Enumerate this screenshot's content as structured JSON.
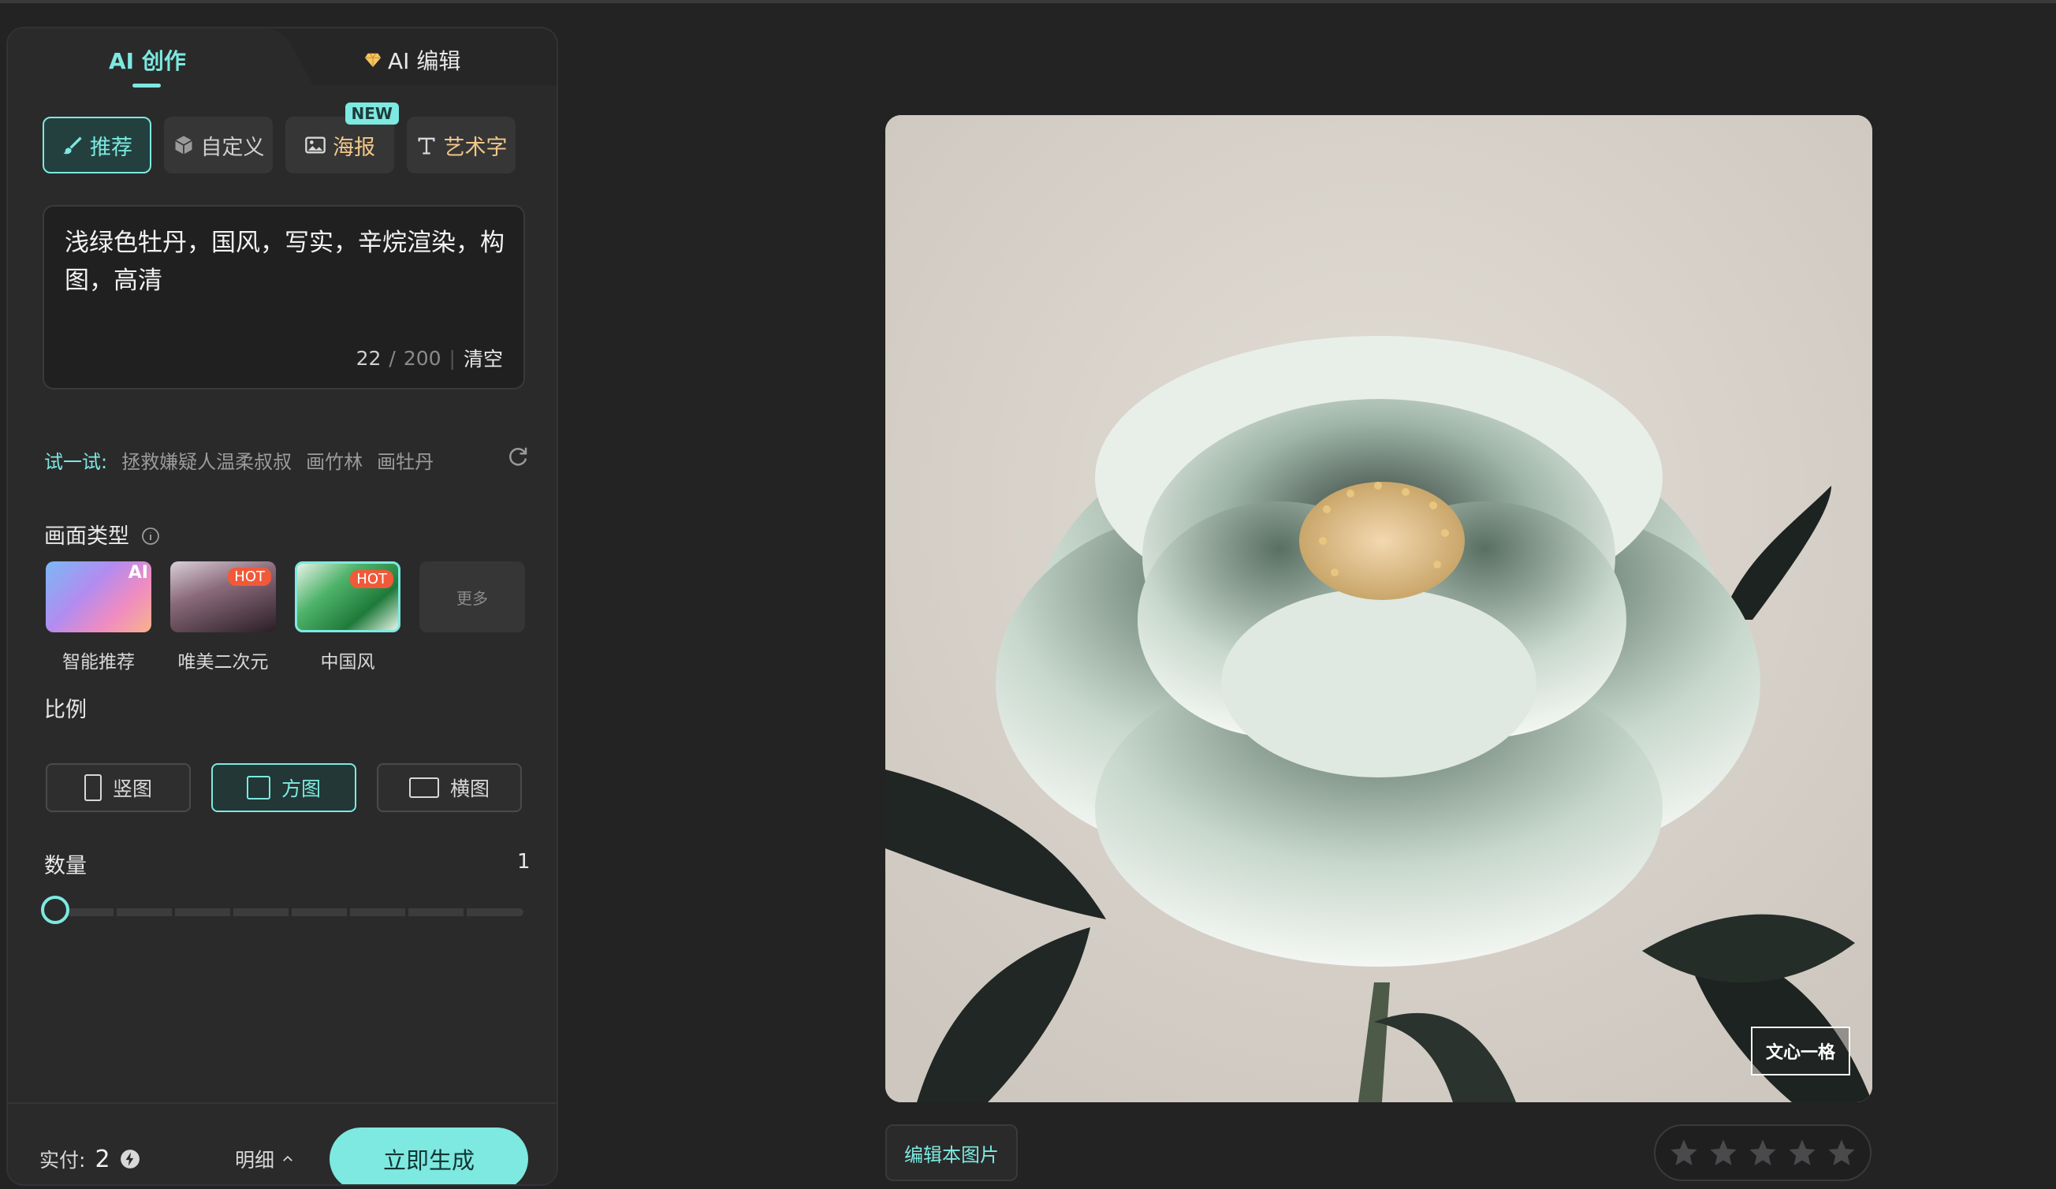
{
  "tabs": {
    "create": "AI 创作",
    "edit": "AI 编辑"
  },
  "modes": [
    {
      "label": "推荐",
      "icon": "brush-icon",
      "active": true
    },
    {
      "label": "自定义",
      "icon": "cube-icon",
      "active": false
    },
    {
      "label": "海报",
      "icon": "image-icon",
      "active": false,
      "badge": "NEW"
    },
    {
      "label": "艺术字",
      "icon": "art-text-icon",
      "active": false
    }
  ],
  "prompt": {
    "text": "浅绿色牡丹，国风，写实，辛烷渲染，构图，高清",
    "count": "22",
    "sep": "/",
    "max": "200",
    "clear": "清空"
  },
  "try": {
    "label": "试一试:",
    "items": [
      "拯救嫌疑人温柔叔叔",
      "画竹林",
      "画牡丹"
    ]
  },
  "style": {
    "title": "画面类型",
    "items": [
      {
        "label": "智能推荐",
        "badge": "AI"
      },
      {
        "label": "唯美二次元",
        "badge": "HOT"
      },
      {
        "label": "中国风",
        "badge": "HOT",
        "selected": true
      }
    ],
    "more": "更多"
  },
  "ratio": {
    "title": "比例",
    "options": [
      {
        "label": "竖图",
        "active": false
      },
      {
        "label": "方图",
        "active": true
      },
      {
        "label": "横图",
        "active": false
      }
    ]
  },
  "quantity": {
    "title": "数量",
    "value": "1"
  },
  "footer": {
    "pay_label": "实付:",
    "pay_value": "2",
    "detail": "明细",
    "generate": "立即生成"
  },
  "result": {
    "watermark": "文心一格",
    "edit_button": "编辑本图片",
    "rating_stars": 5
  },
  "colors": {
    "accent": "#7de9e0",
    "background": "#232323",
    "panel": "#2a2a2b"
  }
}
